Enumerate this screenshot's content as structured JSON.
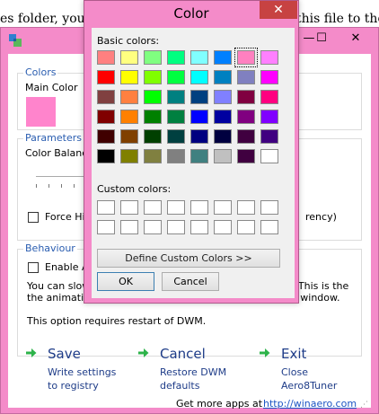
{
  "background": {
    "left_text": "es folder, you w",
    "right_text": "this file to the l"
  },
  "main_window": {
    "min_glyph": "—",
    "max_glyph": "☐",
    "close_glyph": "✕",
    "colors_group": {
      "legend": "Colors",
      "main_color_label": "Main Color",
      "main_color": "#ff84cc"
    },
    "parameters_group": {
      "legend": "Parameters",
      "color_balance_label": "Color Balance",
      "force_label": "Force Hig",
      "force_suffix": "rency)"
    },
    "behaviour_group": {
      "legend": "Behaviour",
      "enable_label": "Enable An",
      "line1_left": "You can slow",
      "line1_right": "y. This is the",
      "line2_left": "the animation",
      "line2_right": "e window.",
      "restart_note": "This option requires restart of DWM."
    },
    "actions": [
      {
        "title": "Save",
        "line1": "Write settings",
        "line2": "to registry"
      },
      {
        "title": "Cancel",
        "line1": "Restore DWM",
        "line2": "defaults"
      },
      {
        "title": "Exit",
        "line1": "Close",
        "line2": "Aero8Tuner"
      }
    ],
    "footer_text": "Get more apps at",
    "footer_link": "http://winaero.com",
    "arrow_color": "#2db34a"
  },
  "color_dialog": {
    "title": "Color",
    "close_glyph": "✕",
    "basic_label": "Basic colors:",
    "custom_label": "Custom colors:",
    "define_button": "Define Custom Colors >>",
    "ok_button": "OK",
    "cancel_button": "Cancel",
    "selected_swatch": "row 1, column 7",
    "basic_colors": [
      [
        "#ff8080",
        "#ffff80",
        "#80ff80",
        "#00ff80",
        "#80ffff",
        "#0080ff",
        "#ff80c0",
        "#ff80ff"
      ],
      [
        "#ff0000",
        "#ffff00",
        "#80ff00",
        "#00ff40",
        "#00ffff",
        "#0080c0",
        "#8080c0",
        "#ff00ff"
      ],
      [
        "#804040",
        "#ff8040",
        "#00ff00",
        "#008080",
        "#004080",
        "#8080ff",
        "#800040",
        "#ff0080"
      ],
      [
        "#800000",
        "#ff8000",
        "#008000",
        "#008040",
        "#0000ff",
        "#0000a0",
        "#800080",
        "#8000ff"
      ],
      [
        "#400000",
        "#804000",
        "#004000",
        "#004040",
        "#000080",
        "#000040",
        "#400040",
        "#400080"
      ],
      [
        "#000000",
        "#808000",
        "#808040",
        "#808080",
        "#408080",
        "#c0c0c0",
        "#400040",
        "#ffffff"
      ]
    ]
  }
}
